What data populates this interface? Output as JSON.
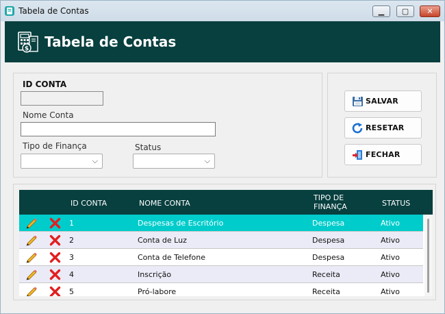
{
  "window": {
    "title": "Tabela de Contas",
    "controls": {
      "minimize": "▁",
      "maximize": "▢",
      "close": "✕"
    },
    "icons": {
      "app": "app-icon"
    }
  },
  "header": {
    "title": "Tabela de Contas",
    "icon": "accounts-ledger-icon",
    "background": "#083f3f"
  },
  "form": {
    "id_label": "ID CONTA",
    "id_value": "",
    "name_label": "Nome Conta",
    "name_value": "",
    "tipo_label": "Tipo de Finança",
    "tipo_value": "",
    "status_label": "Status",
    "status_value": "",
    "chevron": "⌵"
  },
  "buttons": {
    "save": {
      "label": "SALVAR",
      "icon": "floppy-disk-icon"
    },
    "reset": {
      "label": "RESETAR",
      "icon": "refresh-icon"
    },
    "close": {
      "label": "FECHAR",
      "icon": "exit-door-icon"
    }
  },
  "table": {
    "columns": [
      "ID CONTA",
      "NOME CONTA",
      "TIPO DE\nFINANÇA",
      "STATUS"
    ],
    "col_tipo_line1": "TIPO DE",
    "col_tipo_line2": "FINANÇA",
    "selected_row_color": "#00cccc",
    "alt_row_color": "#ebebf7",
    "row_icons": {
      "edit": "pencil-icon",
      "delete": "red-x-icon"
    },
    "rows": [
      {
        "id": "1",
        "nome": "Despesas de Escritório",
        "tipo": "Despesa",
        "status": "Ativo",
        "selected": true
      },
      {
        "id": "2",
        "nome": "Conta de Luz",
        "tipo": "Despesa",
        "status": "Ativo",
        "selected": false
      },
      {
        "id": "3",
        "nome": "Conta de Telefone",
        "tipo": "Despesa",
        "status": "Ativo",
        "selected": false
      },
      {
        "id": "4",
        "nome": "Inscrição",
        "tipo": "Receita",
        "status": "Ativo",
        "selected": false
      },
      {
        "id": "5",
        "nome": "Pró-labore",
        "tipo": "Receita",
        "status": "Ativo",
        "selected": false
      }
    ]
  }
}
